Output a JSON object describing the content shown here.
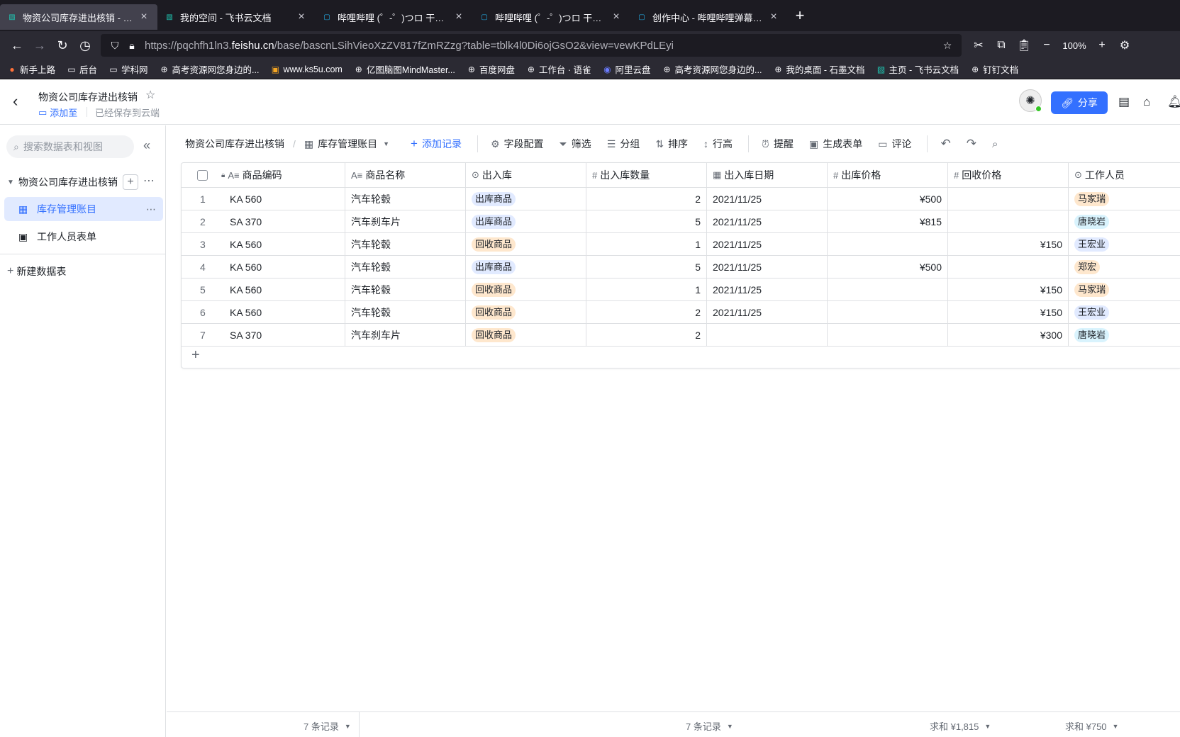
{
  "browser": {
    "tabs": [
      {
        "title": "物资公司库存进出核销 - 飞书云文档",
        "active": true,
        "fav": "feishu-icon"
      },
      {
        "title": "我的空间 - 飞书云文档",
        "active": false,
        "fav": "feishu-icon"
      },
      {
        "title": "哔哩哔哩 (゜-゜)つロ 干杯~-bilibili",
        "active": false,
        "fav": "bilibili-icon"
      },
      {
        "title": "哔哩哔哩 (゜-゜)つロ 干杯~-bilibili",
        "active": false,
        "fav": "bilibili-icon"
      },
      {
        "title": "创作中心 - 哔哩哔哩弹幕视频网",
        "active": false,
        "fav": "bilibili-icon"
      }
    ],
    "url_pre": "https://pqchfh1ln3.",
    "url_host": "feishu.cn",
    "url_post": "/base/bascnLSihVieoXzZV817fZmRZzg?table=tblk4l0Di6ojGsO2&view=vewKPdLEyi",
    "zoom": "100%",
    "bookmarks": [
      {
        "label": "新手上路",
        "icon": "firefox-icon"
      },
      {
        "label": "后台",
        "icon": "folder-icon"
      },
      {
        "label": "学科网",
        "icon": "folder-icon"
      },
      {
        "label": "高考资源网您身边的...",
        "icon": "globe-icon"
      },
      {
        "label": "www.ks5u.com",
        "icon": "ks5u-icon"
      },
      {
        "label": "亿图脑图MindMaster...",
        "icon": "globe-icon"
      },
      {
        "label": "百度网盘",
        "icon": "globe-icon"
      },
      {
        "label": "工作台 · 语雀",
        "icon": "globe-icon"
      },
      {
        "label": "阿里云盘",
        "icon": "aliyun-icon"
      },
      {
        "label": "高考资源网您身边的...",
        "icon": "globe-icon"
      },
      {
        "label": "我的桌面 - 石墨文档",
        "icon": "globe-icon"
      },
      {
        "label": "主页 - 飞书云文档",
        "icon": "feishu-icon"
      },
      {
        "label": "钉钉文档",
        "icon": "globe-icon"
      }
    ]
  },
  "header": {
    "doc_title": "物资公司库存进出核销",
    "add_to": "添加至",
    "saved": "已经保存到云端",
    "share": "分享"
  },
  "sidebar": {
    "search_placeholder": "搜索数据表和视图",
    "base_name": "物资公司库存进出核销",
    "tables": [
      {
        "label": "库存管理账目",
        "active": true
      },
      {
        "label": "工作人员表单",
        "active": false
      }
    ],
    "new_table": "新建数据表"
  },
  "toolbar": {
    "base_crumb": "物资公司库存进出核销",
    "view_crumb": "库存管理账目",
    "add_record": "添加记录",
    "field_config": "字段配置",
    "filter": "筛选",
    "group": "分组",
    "sort": "排序",
    "row_height": "行高",
    "reminder": "提醒",
    "gen_form": "生成表单",
    "comment": "评论"
  },
  "grid": {
    "columns": [
      "商品编码",
      "商品名称",
      "出入库",
      "出入库数量",
      "出入库日期",
      "出库价格",
      "回收价格",
      "工作人员"
    ],
    "rows": [
      {
        "n": "1",
        "code": "KA 560",
        "name": "汽车轮毂",
        "io": "出库商品",
        "io_type": "out",
        "qty": "2",
        "date": "2021/11/25",
        "out_price": "¥500",
        "rec_price": "",
        "staff": "马家瑞",
        "staff_c": "p1"
      },
      {
        "n": "2",
        "code": "SA 370",
        "name": "汽车刹车片",
        "io": "出库商品",
        "io_type": "out",
        "qty": "5",
        "date": "2021/11/25",
        "out_price": "¥815",
        "rec_price": "",
        "staff": "唐晓岩",
        "staff_c": "p2"
      },
      {
        "n": "3",
        "code": "KA 560",
        "name": "汽车轮毂",
        "io": "回收商品",
        "io_type": "rec",
        "qty": "1",
        "date": "2021/11/25",
        "out_price": "",
        "rec_price": "¥150",
        "staff": "王宏业",
        "staff_c": "p3"
      },
      {
        "n": "4",
        "code": "KA 560",
        "name": "汽车轮毂",
        "io": "出库商品",
        "io_type": "out",
        "qty": "5",
        "date": "2021/11/25",
        "out_price": "¥500",
        "rec_price": "",
        "staff": "郑宏",
        "staff_c": "p1"
      },
      {
        "n": "5",
        "code": "KA 560",
        "name": "汽车轮毂",
        "io": "回收商品",
        "io_type": "rec",
        "qty": "1",
        "date": "2021/11/25",
        "out_price": "",
        "rec_price": "¥150",
        "staff": "马家瑞",
        "staff_c": "p1"
      },
      {
        "n": "6",
        "code": "KA 560",
        "name": "汽车轮毂",
        "io": "回收商品",
        "io_type": "rec",
        "qty": "2",
        "date": "2021/11/25",
        "out_price": "",
        "rec_price": "¥150",
        "staff": "王宏业",
        "staff_c": "p3"
      },
      {
        "n": "7",
        "code": "SA 370",
        "name": "汽车刹车片",
        "io": "回收商品",
        "io_type": "rec",
        "qty": "2",
        "date": "",
        "out_price": "",
        "rec_price": "¥300",
        "staff": "唐晓岩",
        "staff_c": "p2"
      }
    ]
  },
  "footer": {
    "count_left": "7 条记录",
    "count_mid": "7 条记录",
    "sum_out": "求和 ¥1,815",
    "sum_rec": "求和 ¥750"
  }
}
